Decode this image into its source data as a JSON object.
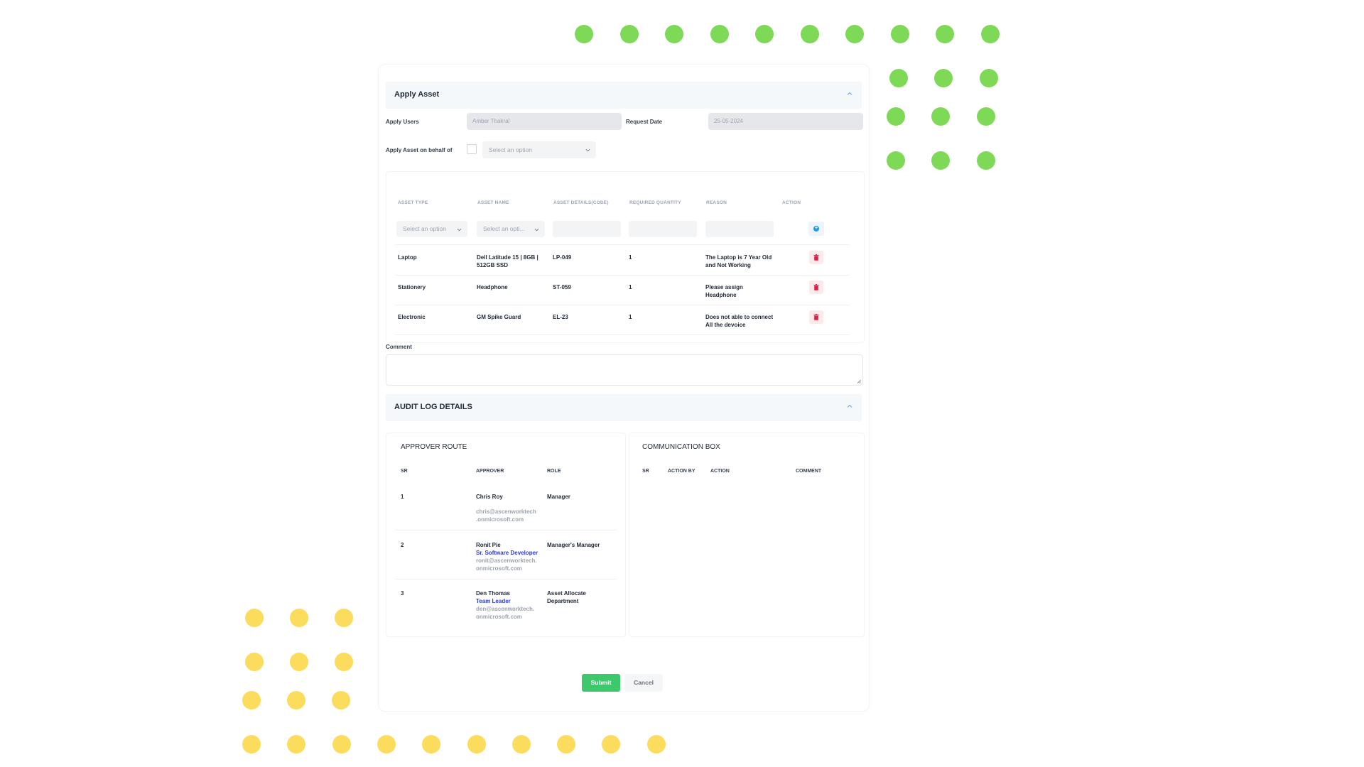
{
  "colors": {
    "green_dot": "#7ed957",
    "yellow_dot": "#fcdc5c",
    "submit": "#3dc86c",
    "delete": "#e11d48",
    "add": "#1d9bf0",
    "link_blue": "#2f3bd6"
  },
  "apply_asset": {
    "title": "Apply Asset",
    "apply_users_label": "Apply Users",
    "apply_users_value": "Amber Thakral",
    "request_date_label": "Request Date",
    "request_date_value": "25-05-2024",
    "behalf_label": "Apply Asset on behalf of",
    "behalf_select": "Select an option"
  },
  "asset_table": {
    "headers": [
      "ASSET TYPE",
      "ASSET NAME",
      "ASSET DETAILS(CODE)",
      "REQUIRED QUANTITY",
      "REASON",
      "ACTION"
    ],
    "new_row": {
      "asset_type": "Select an option",
      "asset_name": "Select an opti..."
    },
    "rows": [
      {
        "type": "Laptop",
        "name_l1": "Dell Latitude 15 | 8GB |",
        "name_l2": "512GB SSD",
        "code": "LP-049",
        "qty": "1",
        "reason_l1": "The Laptop is 7 Year Old",
        "reason_l2": "and Not Working"
      },
      {
        "type": "Stationery",
        "name_l1": "Headphone",
        "name_l2": "",
        "code": "ST-059",
        "qty": "1",
        "reason_l1": "Please assign",
        "reason_l2": "Headphone"
      },
      {
        "type": "Electronic",
        "name_l1": "GM Spike Guard",
        "name_l2": "",
        "code": "EL-23",
        "qty": "1",
        "reason_l1": "Does not able to connect",
        "reason_l2": "All the devoice"
      }
    ]
  },
  "comment_label": "Comment",
  "audit": {
    "title": "AUDIT LOG DETAILS",
    "approver_route": {
      "title": "APPROVER ROUTE",
      "headers": [
        "SR",
        "APPROVER",
        "ROLE"
      ],
      "rows": [
        {
          "sr": "1",
          "name": "Chris Roy",
          "designation": "",
          "email_l1": "chris@ascenworktech",
          "email_l2": ".onmicrosoft.com",
          "role_l1": "Manager",
          "role_l2": ""
        },
        {
          "sr": "2",
          "name": "Ronit Pie",
          "designation": "Sr. Software Developer",
          "email_l1": "ronit@ascenworktech.",
          "email_l2": "onmicrosoft.com",
          "role_l1": "Manager's Manager",
          "role_l2": ""
        },
        {
          "sr": "3",
          "name": "Den Thomas",
          "designation": "Team Leader",
          "email_l1": "den@ascenworktech.",
          "email_l2": "onmicrosoft.com",
          "role_l1": "Asset Allocate",
          "role_l2": "Department"
        }
      ]
    },
    "communication_box": {
      "title": "COMMUNICATION BOX",
      "headers": [
        "SR",
        "ACTION BY",
        "ACTION",
        "COMMENT"
      ]
    }
  },
  "buttons": {
    "submit": "Submit",
    "cancel": "Cancel"
  }
}
